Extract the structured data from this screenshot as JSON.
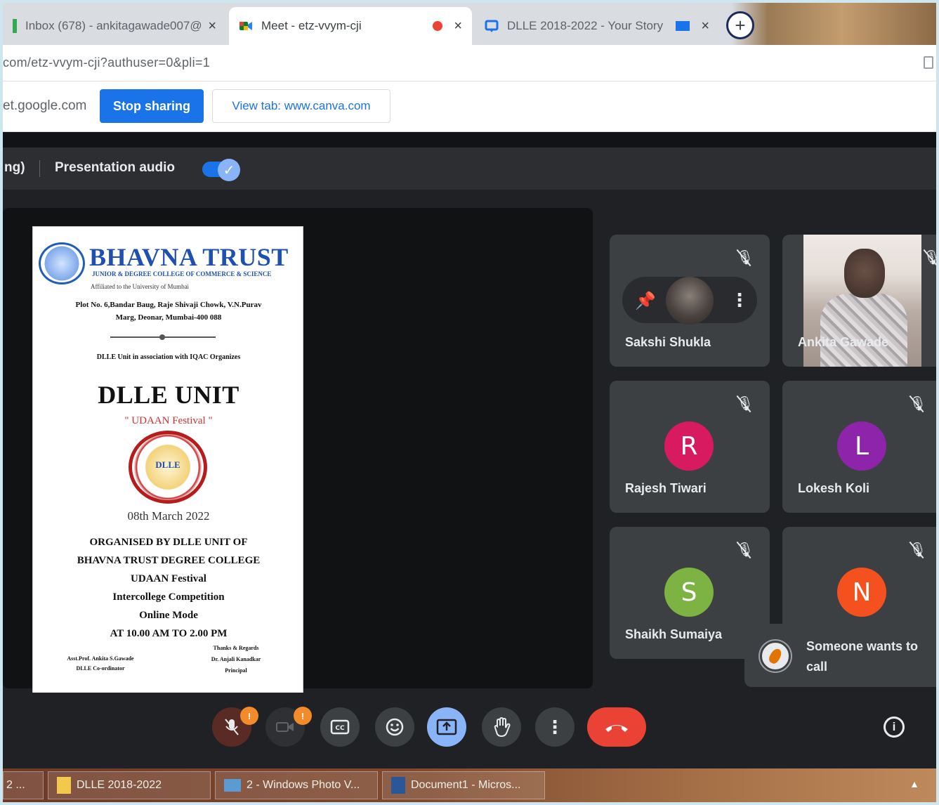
{
  "browser": {
    "tabs": [
      {
        "label": "Inbox (678) - ankitagawade007@",
        "active": false
      },
      {
        "label": "Meet - etz-vvym-cji",
        "active": true,
        "recording": true
      },
      {
        "label": "DLLE 2018-2022 - Your Story",
        "active": false
      }
    ],
    "close_glyph": "×",
    "new_tab_glyph": "+",
    "address": "com/etz-vvym-cji?authuser=0&pli=1"
  },
  "sharing_bar": {
    "domain": "et.google.com",
    "stop_label": "Stop sharing",
    "view_tab_label": "View tab: www.canva.com"
  },
  "presentation_bar": {
    "truncated_label": "ng)",
    "audio_label": "Presentation audio",
    "audio_enabled": true
  },
  "shared_document": {
    "org_name": "BHAVNA TRUST",
    "org_sub": "JUNIOR & DEGREE COLLEGE OF COMMERCE & SCIENCE",
    "affiliation": "Affiliated to the University of Mumbai",
    "address_line1": "Plot No. 6,Bandar Baug, Raje Shivaji Chowk, V.N.Purav",
    "address_line2": "Marg, Deonar, Mumbai-400 088",
    "association": "DLLE Unit in association with IQAC Organizes",
    "title": "DLLE UNIT",
    "festival": "\" UDAAN Festival \"",
    "seal_text": "DLLE",
    "date": "08th March 2022",
    "organised_lines": [
      "ORGANISED BY DLLE UNIT OF",
      "BHAVNA TRUST DEGREE COLLEGE",
      "UDAAN Festival",
      "Intercollege Competition",
      "Online Mode",
      "AT 10.00 AM TO 2.00 PM"
    ],
    "sig_left_line1": "Asst.Prof. Ankita S.Gawade",
    "sig_left_line2": "DLLE Co-ordinator",
    "sig_right_line1": "Thanks & Regards",
    "sig_right_line2": "Dr. Anjali Kanadkar",
    "sig_right_line3": "Principal"
  },
  "participants": [
    {
      "name": "Sakshi Shukla",
      "type": "photo",
      "muted": true
    },
    {
      "name": "Ankita Gawade",
      "type": "video",
      "muted": true
    },
    {
      "name": "Rajesh Tiwari",
      "initial": "R",
      "color": "#d81b60",
      "muted": true
    },
    {
      "name": "Lokesh Koli",
      "initial": "L",
      "color": "#8e24aa",
      "muted": true
    },
    {
      "name": "Shaikh Sumaiya",
      "initial": "S",
      "color": "#7cb342",
      "muted": true
    },
    {
      "name": "",
      "initial": "N",
      "color": "#f4511e",
      "muted": true
    }
  ],
  "tile_icons": {
    "pin": "📌",
    "more": "⋮"
  },
  "toast": {
    "text": "Someone wants to call"
  },
  "controls": {
    "mic_badge": "!",
    "cam_badge": "!",
    "more_glyph": "⋮",
    "info_glyph": "i"
  },
  "taskbar": {
    "items": [
      {
        "label": "2 ..."
      },
      {
        "label": "DLLE 2018-2022"
      },
      {
        "label": "2 - Windows Photo V..."
      },
      {
        "label": "Document1 - Micros..."
      }
    ],
    "tray_arrow": "▲"
  },
  "colors": {
    "meet_bg": "#202124",
    "tile_bg": "#3c4043",
    "accent_blue": "#1a73e8",
    "end_call_red": "#ea4335"
  }
}
